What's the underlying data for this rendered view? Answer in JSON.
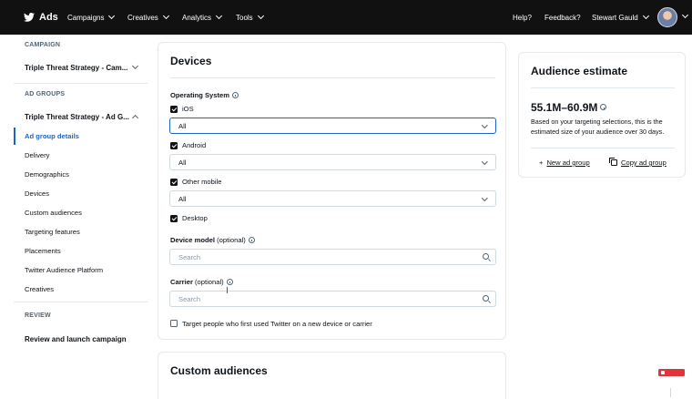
{
  "topnav": {
    "brand": "Ads",
    "items": [
      {
        "label": "Campaigns"
      },
      {
        "label": "Creatives"
      },
      {
        "label": "Analytics"
      },
      {
        "label": "Tools"
      }
    ],
    "help": "Help?",
    "feedback": "Feedback?",
    "user": "Stewart Gauld"
  },
  "sidebar": {
    "campaign_heading": "CAMPAIGN",
    "campaign_name": "Triple Threat Strategy - Cam...",
    "ad_groups_heading": "AD GROUPS",
    "ad_group_name": "Triple Threat Strategy - Ad G...",
    "items": [
      {
        "label": "Ad group details"
      },
      {
        "label": "Delivery"
      },
      {
        "label": "Demographics"
      },
      {
        "label": "Devices"
      },
      {
        "label": "Custom audiences"
      },
      {
        "label": "Targeting features"
      },
      {
        "label": "Placements"
      },
      {
        "label": "Twitter Audience Platform"
      },
      {
        "label": "Creatives"
      }
    ],
    "review_heading": "REVIEW",
    "review_item": "Review and launch campaign"
  },
  "devices": {
    "title": "Devices",
    "os_label": "Operating System",
    "ios": {
      "label": "iOS",
      "checked": true,
      "select": "All"
    },
    "android": {
      "label": "Android",
      "checked": true,
      "select": "All"
    },
    "other": {
      "label": "Other mobile",
      "checked": true,
      "select": "All"
    },
    "desktop": {
      "label": "Desktop",
      "checked": true
    },
    "device_model_label": "Device model",
    "carrier_label": "Carrier",
    "optional": "(optional)",
    "search_placeholder": "Search",
    "new_device_label": "Target people who first used Twitter on a new device or carrier"
  },
  "custom_audiences": {
    "title": "Custom audiences"
  },
  "audience": {
    "title": "Audience estimate",
    "range": "55.1M–60.9M",
    "description": "Based on your targeting selections, this is the estimated size of your audience over 30 days.",
    "new_ad_group": "New ad group",
    "new_prefix": "+",
    "copy_ad_group": "Copy ad group"
  },
  "colors": {
    "accent": "#1d65c8",
    "topbar": "#111111",
    "text": "#0f1419"
  }
}
